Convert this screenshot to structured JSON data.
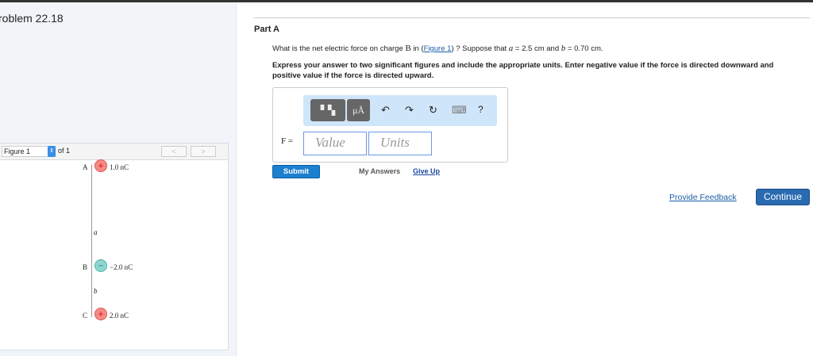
{
  "problem_title": "roblem 22.18",
  "figure": {
    "selector": "Figure 1",
    "of": "of 1",
    "prev": "<",
    "next": ">",
    "charges": [
      {
        "label": "A",
        "sign": "+",
        "value": "1.0 nC"
      },
      {
        "label": "B",
        "sign": "−",
        "value": "−2.0 nC"
      },
      {
        "label": "C",
        "sign": "+",
        "value": "2.0 nC"
      }
    ],
    "dist_a": "a",
    "dist_b": "b"
  },
  "part": "Part A",
  "question": {
    "pre": "What is the net electric force on charge ",
    "charge": "B",
    "mid": " in (",
    "link": "Figure 1",
    "mid2": ") ? Suppose that ",
    "a_sym": "a",
    "a_val": " = 2.5 cm and ",
    "b_sym": "b",
    "b_val": " = 0.70 cm."
  },
  "instructions": "Express your answer to two significant figures and include the appropriate units. Enter negative value if the force is directed downward and positive value if the force is directed upward.",
  "toolbar": {
    "units_btn": "μÅ",
    "undo": "↶",
    "redo": "↷",
    "reset": "↻",
    "keyboard": "⌨",
    "help": "?"
  },
  "answer": {
    "label": "F =",
    "value_placeholder": "Value",
    "units_placeholder": "Units"
  },
  "submit": "Submit",
  "my_answers": "My Answers",
  "give_up": "Give Up",
  "feedback": "Provide Feedback",
  "continue": "Continue"
}
